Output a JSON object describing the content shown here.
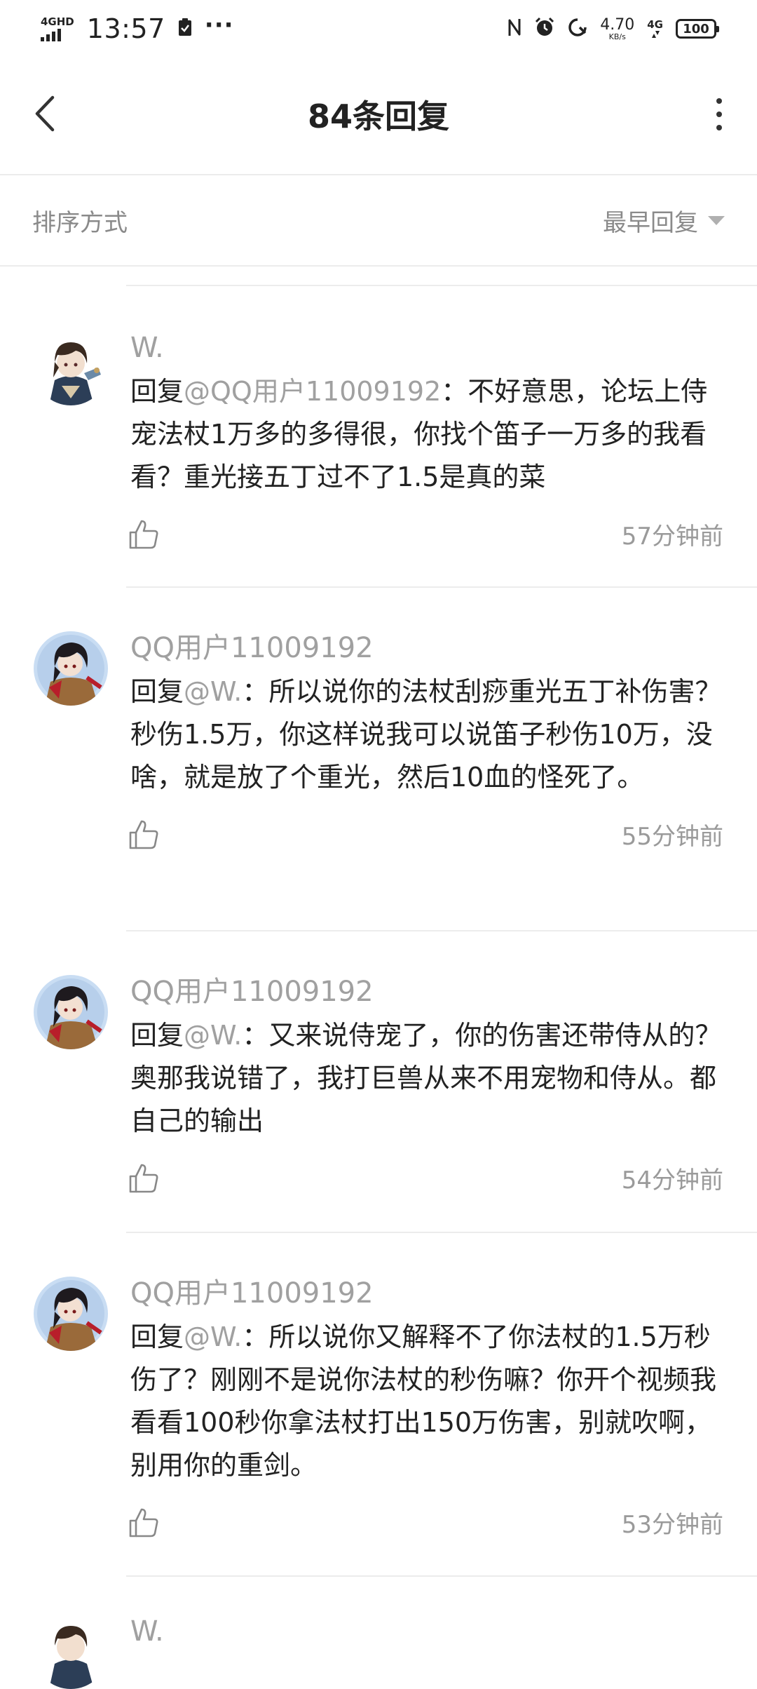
{
  "status_bar": {
    "network_label": "4GHD",
    "time": "13:57",
    "more_dots": "···",
    "speed_value": "4.70",
    "speed_unit": "KB/s",
    "cell_label": "4G",
    "battery": "100"
  },
  "header": {
    "title": "84条回复"
  },
  "sort": {
    "label": "排序方式",
    "selected": "最早回复"
  },
  "replies": [
    {
      "username": "W.",
      "reply_prefix": "回复",
      "mention": "@QQ用户11009192",
      "text": "：不好意思，论坛上侍宠法杖1万多的多得很，你找个笛子一万多的我看看？重光接五丁过不了1.5是真的菜",
      "time": "57分钟前",
      "avatar": "w-avatar"
    },
    {
      "username": "QQ用户11009192",
      "reply_prefix": "回复",
      "mention": "@W.",
      "text": "：所以说你的法杖刮痧重光五丁补伤害？秒伤1.5万，你这样说我可以说笛子秒伤10万，没啥，就是放了个重光，然后10血的怪死了。",
      "time": "55分钟前",
      "avatar": "qq-avatar"
    },
    {
      "username": "QQ用户11009192",
      "reply_prefix": "回复",
      "mention": "@W.",
      "text": "：又来说侍宠了，你的伤害还带侍从的？奥那我说错了，我打巨兽从来不用宠物和侍从。都自己的输出",
      "time": "54分钟前",
      "avatar": "qq-avatar"
    },
    {
      "username": "QQ用户11009192",
      "reply_prefix": "回复",
      "mention": "@W.",
      "text": "：所以说你又解释不了你法杖的1.5万秒伤了？刚刚不是说你法杖的秒伤嘛？你开个视频我看看100秒你拿法杖打出150万伤害，别就吹啊，别用你的重剑。",
      "time": "53分钟前",
      "avatar": "qq-avatar"
    },
    {
      "username": "W.",
      "avatar": "w-avatar"
    }
  ],
  "icons": {
    "back": "chevron-left-icon",
    "more": "more-vertical-icon",
    "sort_caret": "caret-down-icon",
    "like": "thumbs-up-icon"
  },
  "colors": {
    "text_primary": "#222222",
    "text_secondary": "#a0a0a0",
    "divider": "#ececec",
    "background": "#ffffff"
  }
}
